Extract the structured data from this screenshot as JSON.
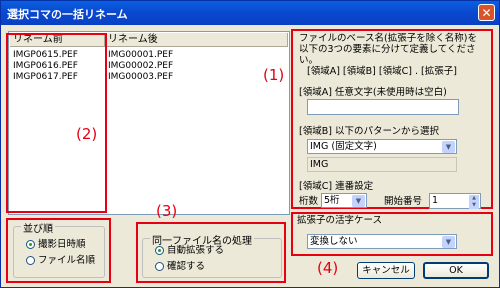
{
  "window": {
    "title": "選択コマの一括リネーム",
    "close_label": "✕"
  },
  "list": {
    "col_before": "リネーム前",
    "col_after": "リネーム後",
    "rows": [
      {
        "before": "IMGP0615.PEF",
        "after": "IMG00001.PEF"
      },
      {
        "before": "IMGP0616.PEF",
        "after": "IMG00002.PEF"
      },
      {
        "before": "IMGP0617.PEF",
        "after": "IMG00003.PEF"
      }
    ]
  },
  "callouts": {
    "c1": "(1)",
    "c2": "(2)",
    "c3": "(3)",
    "c4": "(4)"
  },
  "sort": {
    "group_label": "並び順",
    "option_date": "撮影日時順",
    "option_name": "ファイル名順",
    "selected": "撮影日時順"
  },
  "duplicate": {
    "group_label": "同一ファイル名の処理",
    "option_auto": "自動拡張する",
    "option_confirm": "確認する",
    "selected": "自動拡張する"
  },
  "rename": {
    "description": "ファイルのベース名(拡張子を除く名称)を以下の3つの要素に分けて定義してください。",
    "format_line": "[領域A] [領域B] [領域C] . [拡張子]",
    "area_a_label": "[領域A] 任意文字(未使用時は空白)",
    "area_a_value": "",
    "area_b_label": "[領域B] 以下のパターンから選択",
    "area_b_selected": "IMG (固定文字)",
    "area_b_preview": "IMG",
    "area_c_label": "[領域C] 連番設定",
    "digits_label": "桁数",
    "digits_value": "5桁",
    "start_label": "開始番号",
    "start_value": "1"
  },
  "ext_case": {
    "group_label": "拡張子の活字ケース",
    "selected": "変換しない"
  },
  "buttons": {
    "cancel": "キャンセル",
    "ok": "OK"
  }
}
